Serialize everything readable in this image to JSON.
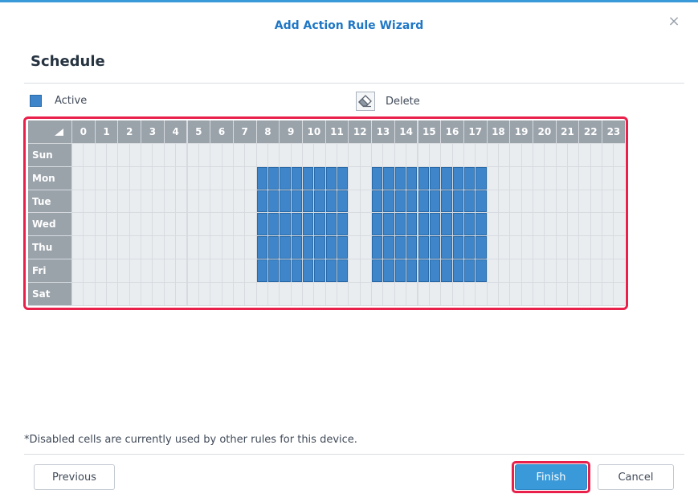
{
  "dialog": {
    "title": "Add Action Rule Wizard",
    "close_icon": "close-icon",
    "close_glyph": "×"
  },
  "section": {
    "title": "Schedule"
  },
  "legend": {
    "active_label": "Active",
    "delete_label": "Delete",
    "active_color": "#3e86c9",
    "delete_icon": "eraser-icon"
  },
  "schedule": {
    "hours": [
      "0",
      "1",
      "2",
      "3",
      "4",
      "5",
      "6",
      "7",
      "8",
      "9",
      "10",
      "11",
      "12",
      "13",
      "14",
      "15",
      "16",
      "17",
      "18",
      "19",
      "20",
      "21",
      "22",
      "23"
    ],
    "days": [
      "Sun",
      "Mon",
      "Tue",
      "Wed",
      "Thu",
      "Fri",
      "Sat"
    ],
    "half_hour_slots": true,
    "active": {
      "Sun": [],
      "Mon": [
        [
          "8:00",
          "12:00"
        ],
        [
          "13:00",
          "18:00"
        ]
      ],
      "Tue": [
        [
          "8:00",
          "12:00"
        ],
        [
          "13:00",
          "18:00"
        ]
      ],
      "Wed": [
        [
          "8:00",
          "12:00"
        ],
        [
          "13:00",
          "18:00"
        ]
      ],
      "Thu": [
        [
          "8:00",
          "12:00"
        ],
        [
          "13:00",
          "18:00"
        ]
      ],
      "Fri": [
        [
          "8:00",
          "12:00"
        ],
        [
          "13:00",
          "18:00"
        ]
      ],
      "Sat": []
    },
    "colors": {
      "active": "#3e86c9",
      "inactive": "#eaedf0",
      "header": "#9aa2aa",
      "highlight": "#e8204a"
    }
  },
  "footnote": "*Disabled cells are currently used by other rules for this device.",
  "buttons": {
    "previous": "Previous",
    "finish": "Finish",
    "cancel": "Cancel"
  }
}
